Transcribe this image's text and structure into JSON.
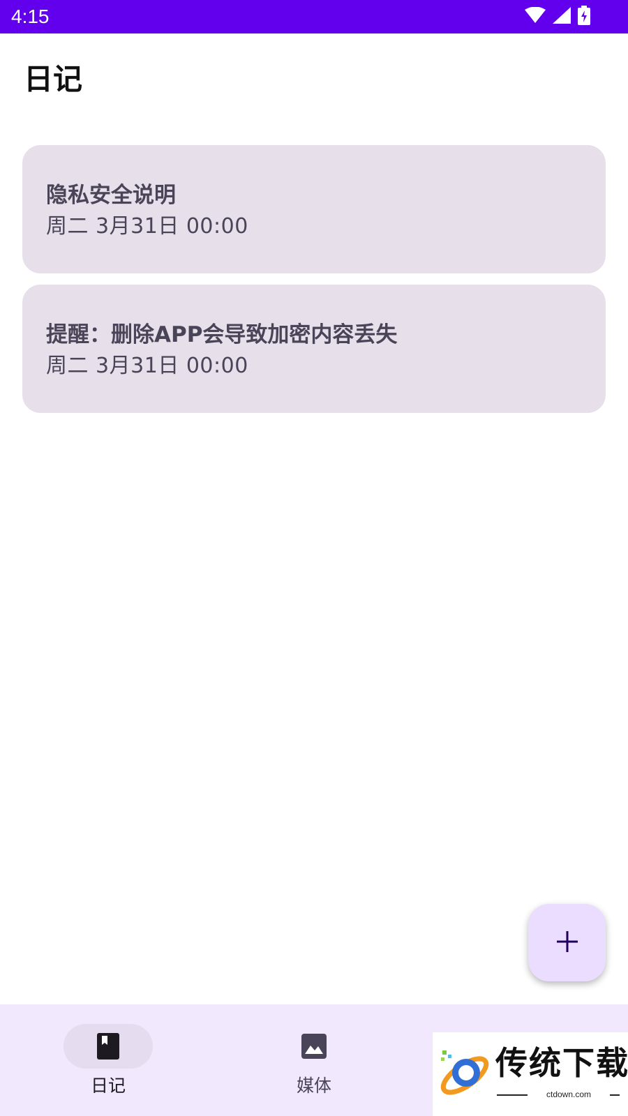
{
  "status_bar": {
    "time": "4:15",
    "color": "#6200ee",
    "icons": [
      "wifi-icon",
      "cell-signal-icon",
      "battery-charging-icon"
    ]
  },
  "page": {
    "title": "日记"
  },
  "entries": [
    {
      "title": "隐私安全说明",
      "date": "周二 3月31日 00:00"
    },
    {
      "title": "提醒：删除APP会导致加密内容丢失",
      "date": "周二 3月31日 00:00"
    }
  ],
  "fab": {
    "icon": "plus-icon",
    "color": "#eaddff"
  },
  "bottom_nav": {
    "items": [
      {
        "label": "日记",
        "icon": "book-icon",
        "selected": true
      },
      {
        "label": "媒体",
        "icon": "image-icon",
        "selected": false
      }
    ]
  },
  "watermark": {
    "text": "传统下载",
    "subtext": "ctdown.com"
  },
  "colors": {
    "accent": "#6200ee",
    "card": "#e7dfea",
    "nav_bg": "#f1e8fd"
  }
}
